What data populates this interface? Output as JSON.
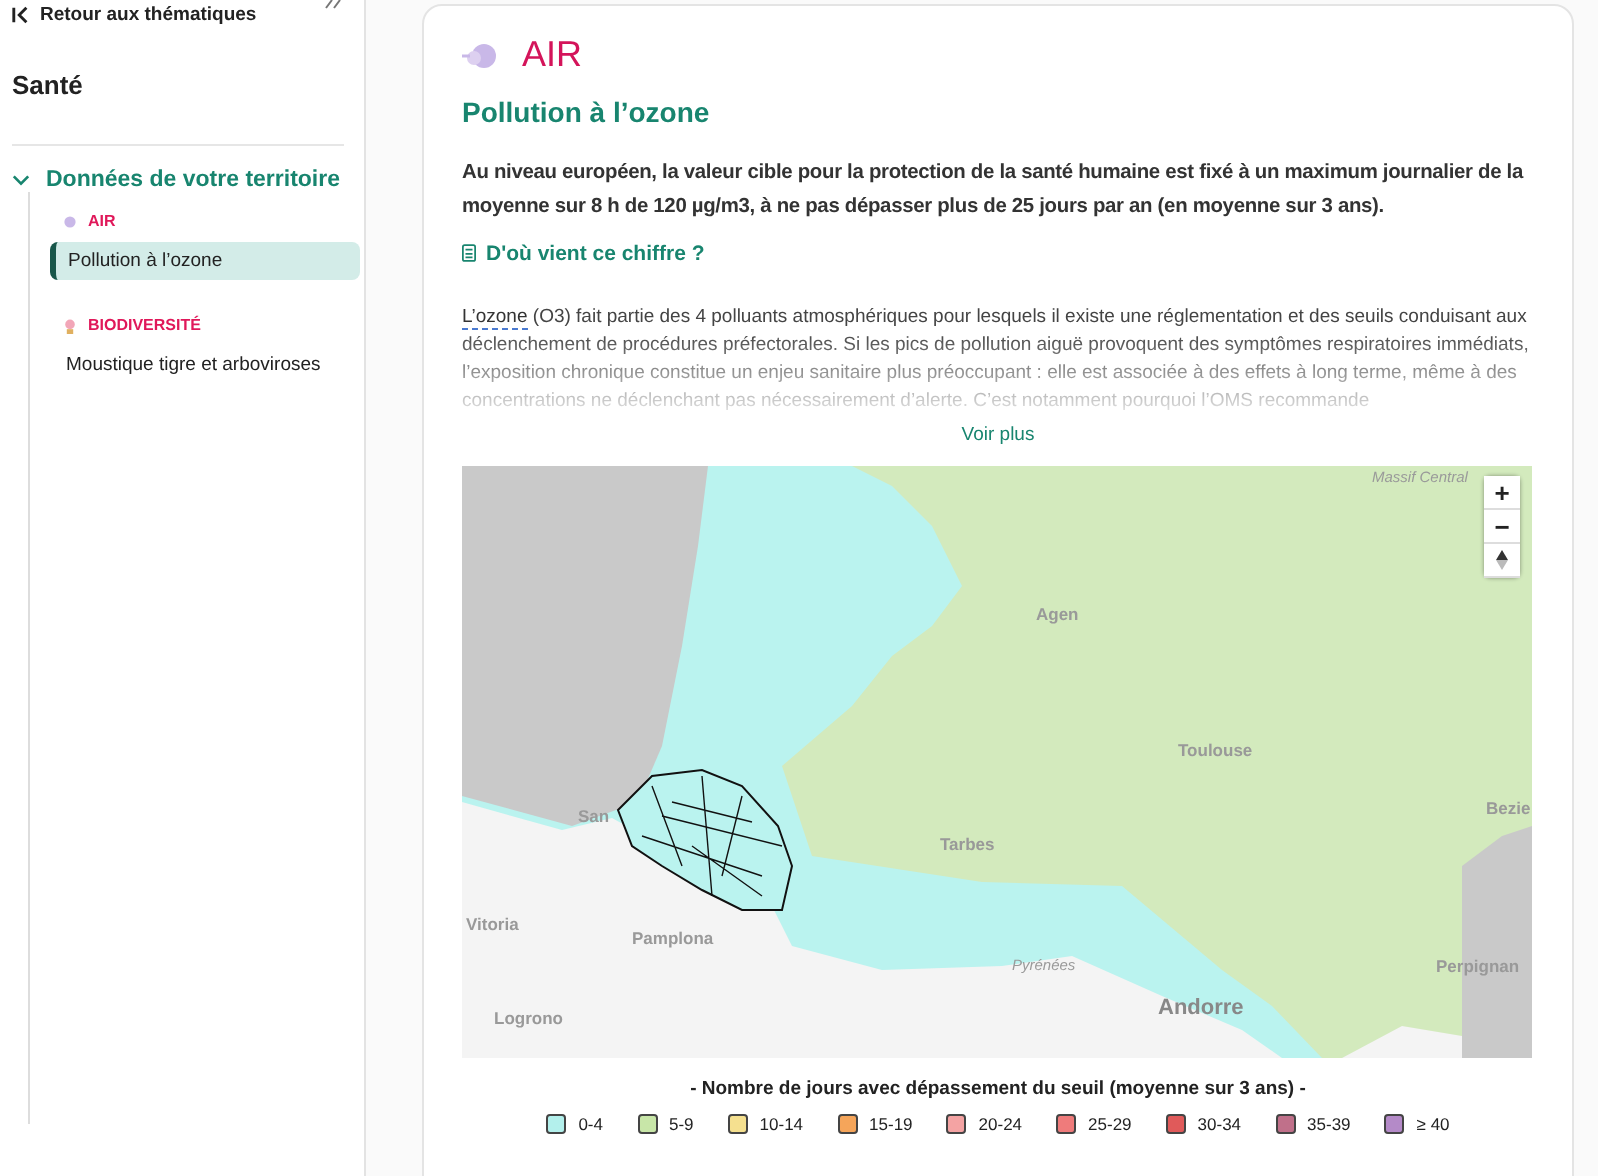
{
  "sidebar": {
    "back_link": "Retour aux thématiques",
    "title": "Santé",
    "section": {
      "label": "Données de votre territoire",
      "expanded": true,
      "groups": [
        {
          "label": "AIR",
          "kind": "air",
          "items": [
            {
              "label": "Pollution à l’ozone",
              "selected": true
            }
          ]
        },
        {
          "label": "BIODIVERSITÉ",
          "kind": "bio",
          "items": [
            {
              "label": "Moustique tigre et arboviroses",
              "selected": false
            }
          ]
        }
      ]
    }
  },
  "main": {
    "category": "AIR",
    "title": "Pollution à l’ozone",
    "highlight": "Au niveau européen, la valeur cible pour la protection de la santé humaine est fixé à un maximum journalier de la moyenne sur 8 h de 120 µg/m3, à ne pas dépasser plus de 25 jours par an (en moyenne sur 3 ans).",
    "source_link": "D'où vient ce chiffre ?",
    "intro": {
      "term": "L’ozone",
      "text": " (O3) fait partie des 4 polluants atmosphériques pour lesquels il existe une réglementation et des seuils conduisant aux déclenchement de procédures préfectorales. Si les pics de pollution aiguë provoquent des symptômes respiratoires immédiats, l’exposition chronique constitue un enjeu sanitaire plus préoccupant : elle est associée à des effets à long terme, même à des concentrations ne déclenchant pas nécessairement d’alerte. C’est notamment pourquoi l’OMS recommande"
    },
    "more_link": "Voir plus",
    "map": {
      "labels": [
        {
          "text": "Massif Central",
          "kind": "region"
        },
        {
          "text": "Agen",
          "kind": "city"
        },
        {
          "text": "Toulouse",
          "kind": "city"
        },
        {
          "text": "Tarbes",
          "kind": "city"
        },
        {
          "text": "Bezie",
          "kind": "city"
        },
        {
          "text": "San",
          "kind": "city"
        },
        {
          "text": "Vitoria",
          "kind": "city"
        },
        {
          "text": "Pamplona",
          "kind": "city"
        },
        {
          "text": "Logrono",
          "kind": "city"
        },
        {
          "text": "Perpignan",
          "kind": "city"
        },
        {
          "text": "Pyrénées",
          "kind": "region"
        },
        {
          "text": "Andorre",
          "kind": "country"
        }
      ],
      "controls": [
        "+",
        "−"
      ]
    },
    "legend": {
      "title": "- Nombre de jours avec dépassement du seuil (moyenne sur 3 ans) -",
      "items": [
        {
          "label": "0-4",
          "color": "#b3f0ec"
        },
        {
          "label": "5-9",
          "color": "#c8e6a8"
        },
        {
          "label": "10-14",
          "color": "#f5e08f"
        },
        {
          "label": "15-19",
          "color": "#f5a55a"
        },
        {
          "label": "20-24",
          "color": "#f4a3a3"
        },
        {
          "label": "25-29",
          "color": "#ef7b7b"
        },
        {
          "label": "30-34",
          "color": "#e05a5a"
        },
        {
          "label": "35-39",
          "color": "#c0708a"
        },
        {
          "label": "≥ 40",
          "color": "#b48ac8"
        }
      ]
    }
  }
}
